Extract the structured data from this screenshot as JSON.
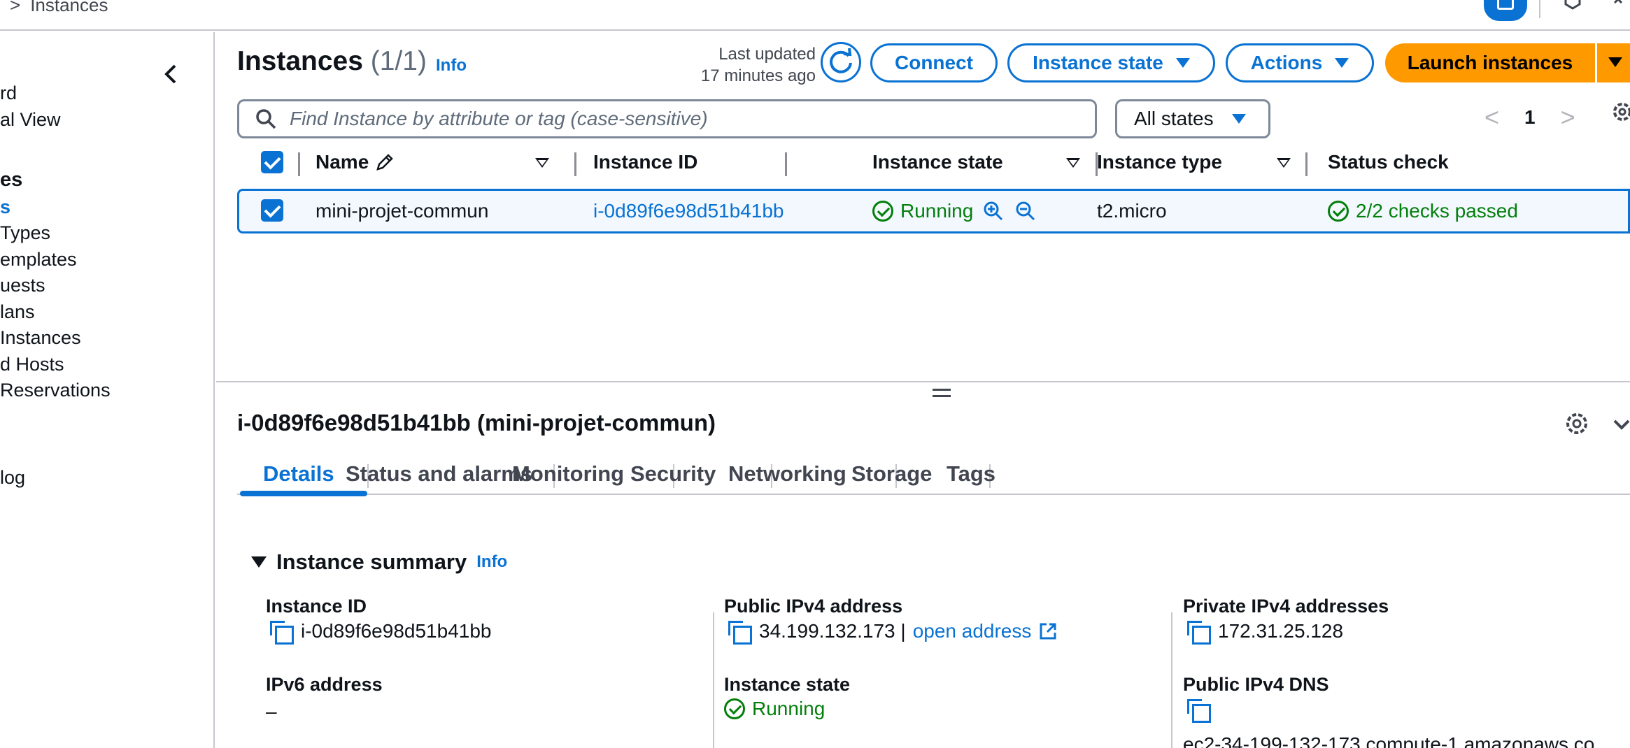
{
  "breadcrumb": {
    "current": "Instances",
    "separator": ">"
  },
  "sidebar": {
    "items": [
      {
        "label": "rd",
        "kind": "link"
      },
      {
        "label": "al View",
        "kind": "link"
      },
      {
        "label": "es",
        "kind": "header"
      },
      {
        "label": "s",
        "kind": "active"
      },
      {
        "label": "Types",
        "kind": "link"
      },
      {
        "label": "emplates",
        "kind": "link"
      },
      {
        "label": "uests",
        "kind": "link"
      },
      {
        "label": "lans",
        "kind": "link"
      },
      {
        "label": " Instances",
        "kind": "link"
      },
      {
        "label": "d Hosts",
        "kind": "link"
      },
      {
        "label": "Reservations",
        "kind": "link"
      },
      {
        "label": "log",
        "kind": "link"
      }
    ]
  },
  "header": {
    "title": "Instances",
    "count": "(1/1)",
    "info": "Info",
    "last_updated_line1": "Last updated",
    "last_updated_line2": "17 minutes ago",
    "connect": "Connect",
    "instance_state": "Instance state",
    "actions": "Actions",
    "launch": "Launch instances"
  },
  "filter": {
    "placeholder": "Find Instance by attribute or tag (case-sensitive)",
    "states": "All states",
    "page": "1",
    "prev": "<",
    "next": ">"
  },
  "table": {
    "columns": {
      "name": "Name",
      "instance_id": "Instance ID",
      "instance_state": "Instance state",
      "instance_type": "Instance type",
      "status_check": "Status check"
    },
    "rows": [
      {
        "name": "mini-projet-commun",
        "instance_id": "i-0d89f6e98d51b41bb",
        "instance_state": "Running",
        "instance_type": "t2.micro",
        "status_check": "2/2 checks passed"
      }
    ]
  },
  "detail": {
    "title": "i-0d89f6e98d51b41bb (mini-projet-commun)",
    "tabs": [
      "Details",
      "Status and alarms",
      "Monitoring",
      "Security",
      "Networking",
      "Storage",
      "Tags"
    ],
    "summary_title": "Instance summary",
    "summary_info": "Info",
    "fields": {
      "instance_id_label": "Instance ID",
      "instance_id_value": "i-0d89f6e98d51b41bb",
      "ipv6_label": "IPv6 address",
      "ipv6_value": "–",
      "public_ipv4_label": "Public IPv4 address",
      "public_ipv4_value": "34.199.132.173 |",
      "open_address": "open address",
      "instance_state_label": "Instance state",
      "instance_state_value": "Running",
      "private_ipv4_label": "Private IPv4 addresses",
      "private_ipv4_value": "172.31.25.128",
      "public_dns_label": "Public IPv4 DNS",
      "public_dns_value": "ec2-34-199-132-173.compute-1.amazonaws.co"
    }
  },
  "colors": {
    "accent": "#0972d3",
    "launch": "#ff9900",
    "success": "#037f0c",
    "border": "#c6c6cd"
  }
}
